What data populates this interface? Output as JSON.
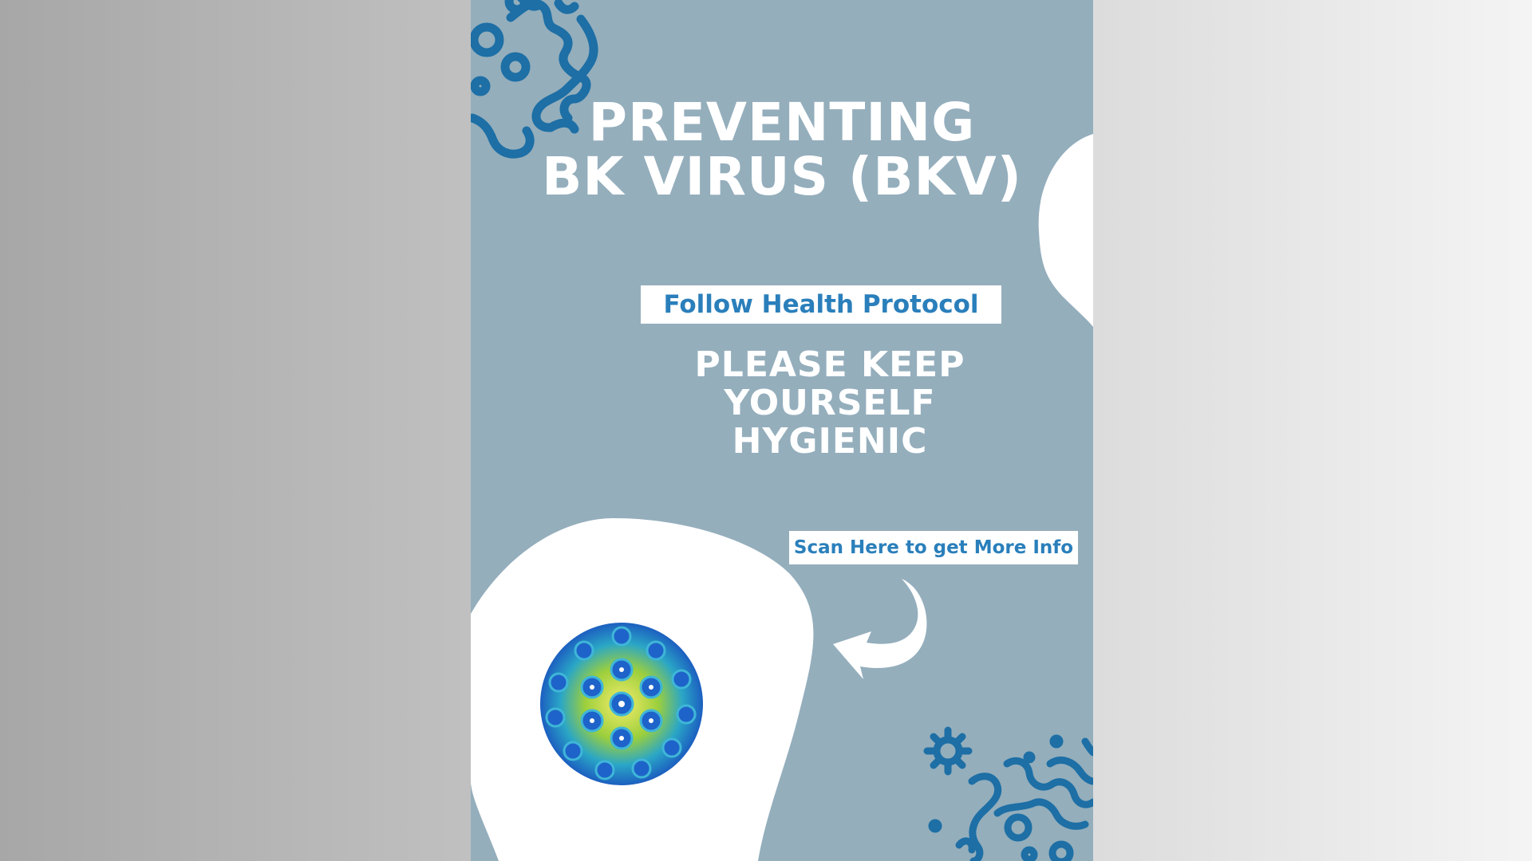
{
  "poster": {
    "title_line1": "PREVENTING",
    "title_line2": "BK VIRUS (BKV)",
    "protocol_tag": "Follow Health Protocol",
    "hygiene_line1": "PLEASE KEEP",
    "hygiene_line2": "YOURSELF",
    "hygiene_line3": "HYGIENIC",
    "scan_tag": "Scan Here to get More Info"
  },
  "colors": {
    "poster_bg": "#94aebc",
    "accent_blue": "#2a7fbb",
    "deco_blue": "#1d6fa5",
    "text_white": "#ffffff"
  },
  "icons": [
    "virus-cluster-icon",
    "arrow-curve-icon",
    "virus-particle-image",
    "virus-small-icon"
  ]
}
